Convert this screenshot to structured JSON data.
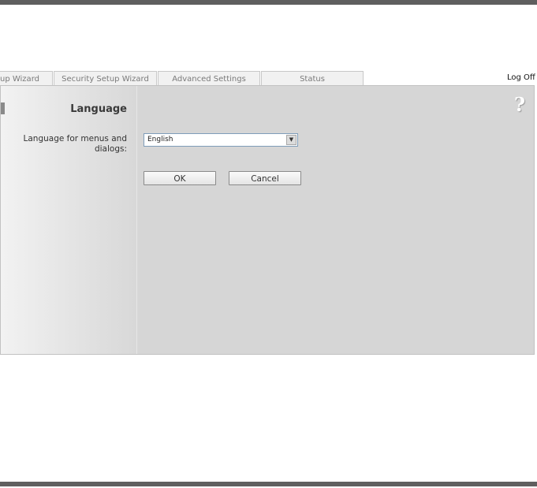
{
  "tabs": [
    {
      "label": "up Wizard"
    },
    {
      "label": "Security Setup Wizard"
    },
    {
      "label": "Advanced Settings"
    },
    {
      "label": "Status"
    }
  ],
  "header": {
    "logoff_label": "Log Off"
  },
  "panel": {
    "title": "Language",
    "help_icon": "question-mark-icon",
    "language_label": "Language for menus and dialogs:",
    "language_select": {
      "value": "English"
    },
    "ok_label": "OK",
    "cancel_label": "Cancel"
  }
}
